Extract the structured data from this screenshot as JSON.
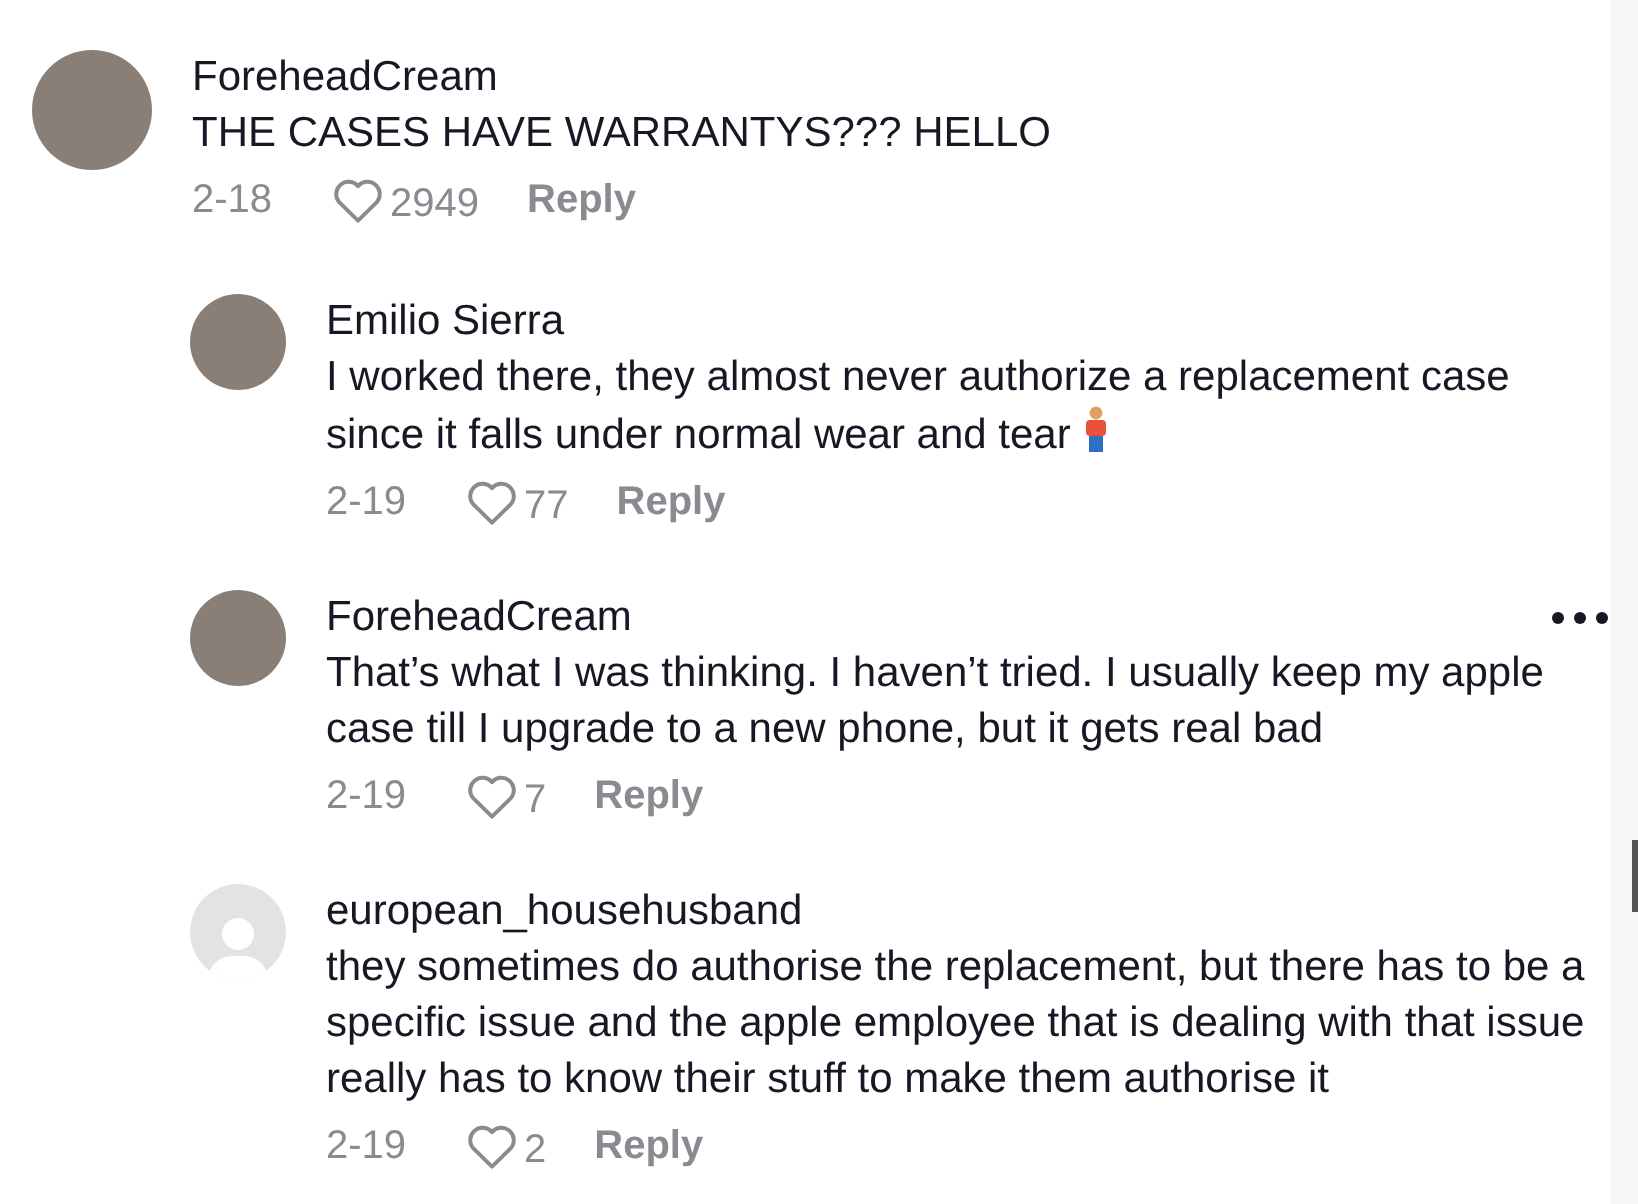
{
  "comments": [
    {
      "kind": "photo",
      "username": "ForeheadCream",
      "text": "THE CASES HAVE WARRANTYS??? HELLO",
      "date": "2-18",
      "likes": "2949",
      "reply_label": "Reply",
      "emoji": false,
      "more_menu": false,
      "replies": [
        {
          "kind": "photo",
          "username": "Emilio Sierra",
          "text": "I worked there, they almost never authorize a replacement case since it falls under normal wear and tear",
          "emoji": true,
          "date": "2-19",
          "likes": "77",
          "reply_label": "Reply",
          "more_menu": false
        },
        {
          "kind": "photo",
          "username": "ForeheadCream",
          "text": "That’s what I was thinking. I haven’t tried. I usually keep my apple case till I upgrade to a new phone, but it gets real bad",
          "emoji": false,
          "date": "2-19",
          "likes": "7",
          "reply_label": "Reply",
          "more_menu": true
        },
        {
          "kind": "default",
          "username": "european_househusband",
          "text": "they sometimes do authorise the replacement, but there has to be a specific issue and the apple employee that is dealing with that issue really has to know their stuff to make them authorise it",
          "emoji": false,
          "date": "2-19",
          "likes": "2",
          "reply_label": "Reply",
          "more_menu": false
        }
      ]
    }
  ]
}
